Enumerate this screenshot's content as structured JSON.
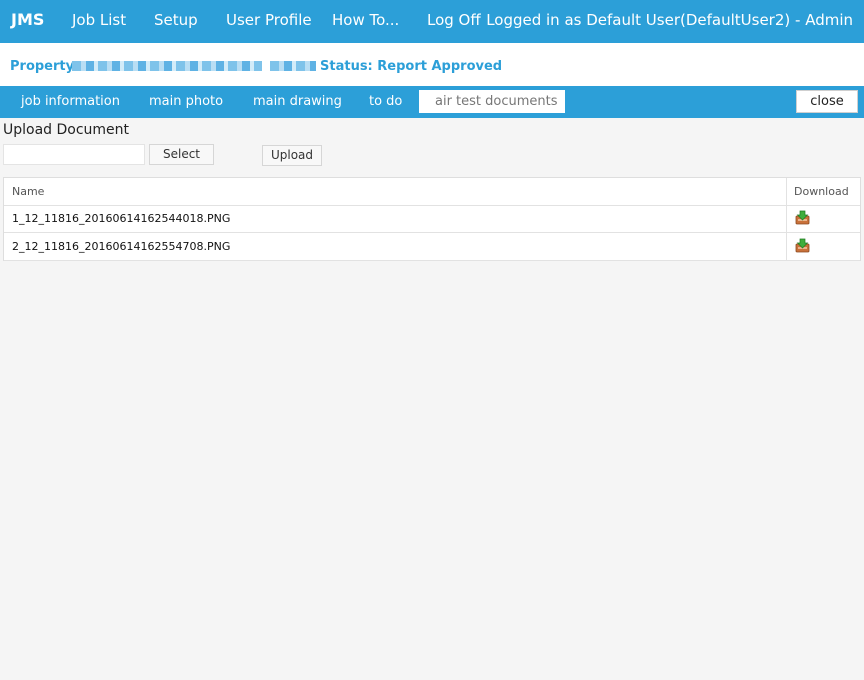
{
  "nav": {
    "brand": "JMS",
    "items": [
      "Job List",
      "Setup",
      "User Profile",
      "How To...",
      "Log Off"
    ],
    "user_text": "Logged in as Default User(DefaultUser2) - Admin"
  },
  "info": {
    "property_label": "Property:",
    "status_text": "Status: Report Approved"
  },
  "tabs": {
    "items": [
      "job information",
      "main photo",
      "main drawing",
      "to do",
      "air test documents"
    ],
    "active": "air test documents",
    "close_label": "close"
  },
  "upload": {
    "title": "Upload Document",
    "file_value": "",
    "select_label": "Select",
    "upload_label": "Upload"
  },
  "table": {
    "headers": {
      "name": "Name",
      "download": "Download"
    },
    "rows": [
      {
        "name": "1_12_11816_20160614162544018.PNG",
        "download_icon": "download-icon"
      },
      {
        "name": "2_12_11816_20160614162554708.PNG",
        "download_icon": "download-icon"
      }
    ]
  },
  "colors": {
    "brand_blue": "#2c9fd8",
    "background": "#f5f5f5"
  }
}
